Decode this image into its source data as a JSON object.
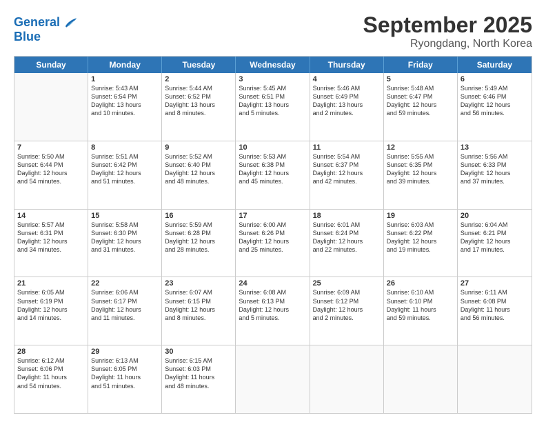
{
  "logo": {
    "line1": "General",
    "line2": "Blue"
  },
  "title": "September 2025",
  "subtitle": "Ryongdang, North Korea",
  "days": [
    "Sunday",
    "Monday",
    "Tuesday",
    "Wednesday",
    "Thursday",
    "Friday",
    "Saturday"
  ],
  "rows": [
    [
      {
        "day": "",
        "empty": true
      },
      {
        "day": "1",
        "l1": "Sunrise: 5:43 AM",
        "l2": "Sunset: 6:54 PM",
        "l3": "Daylight: 13 hours",
        "l4": "and 10 minutes."
      },
      {
        "day": "2",
        "l1": "Sunrise: 5:44 AM",
        "l2": "Sunset: 6:52 PM",
        "l3": "Daylight: 13 hours",
        "l4": "and 8 minutes."
      },
      {
        "day": "3",
        "l1": "Sunrise: 5:45 AM",
        "l2": "Sunset: 6:51 PM",
        "l3": "Daylight: 13 hours",
        "l4": "and 5 minutes."
      },
      {
        "day": "4",
        "l1": "Sunrise: 5:46 AM",
        "l2": "Sunset: 6:49 PM",
        "l3": "Daylight: 13 hours",
        "l4": "and 2 minutes."
      },
      {
        "day": "5",
        "l1": "Sunrise: 5:48 AM",
        "l2": "Sunset: 6:47 PM",
        "l3": "Daylight: 12 hours",
        "l4": "and 59 minutes."
      },
      {
        "day": "6",
        "l1": "Sunrise: 5:49 AM",
        "l2": "Sunset: 6:46 PM",
        "l3": "Daylight: 12 hours",
        "l4": "and 56 minutes."
      }
    ],
    [
      {
        "day": "7",
        "l1": "Sunrise: 5:50 AM",
        "l2": "Sunset: 6:44 PM",
        "l3": "Daylight: 12 hours",
        "l4": "and 54 minutes."
      },
      {
        "day": "8",
        "l1": "Sunrise: 5:51 AM",
        "l2": "Sunset: 6:42 PM",
        "l3": "Daylight: 12 hours",
        "l4": "and 51 minutes."
      },
      {
        "day": "9",
        "l1": "Sunrise: 5:52 AM",
        "l2": "Sunset: 6:40 PM",
        "l3": "Daylight: 12 hours",
        "l4": "and 48 minutes."
      },
      {
        "day": "10",
        "l1": "Sunrise: 5:53 AM",
        "l2": "Sunset: 6:38 PM",
        "l3": "Daylight: 12 hours",
        "l4": "and 45 minutes."
      },
      {
        "day": "11",
        "l1": "Sunrise: 5:54 AM",
        "l2": "Sunset: 6:37 PM",
        "l3": "Daylight: 12 hours",
        "l4": "and 42 minutes."
      },
      {
        "day": "12",
        "l1": "Sunrise: 5:55 AM",
        "l2": "Sunset: 6:35 PM",
        "l3": "Daylight: 12 hours",
        "l4": "and 39 minutes."
      },
      {
        "day": "13",
        "l1": "Sunrise: 5:56 AM",
        "l2": "Sunset: 6:33 PM",
        "l3": "Daylight: 12 hours",
        "l4": "and 37 minutes."
      }
    ],
    [
      {
        "day": "14",
        "l1": "Sunrise: 5:57 AM",
        "l2": "Sunset: 6:31 PM",
        "l3": "Daylight: 12 hours",
        "l4": "and 34 minutes."
      },
      {
        "day": "15",
        "l1": "Sunrise: 5:58 AM",
        "l2": "Sunset: 6:30 PM",
        "l3": "Daylight: 12 hours",
        "l4": "and 31 minutes."
      },
      {
        "day": "16",
        "l1": "Sunrise: 5:59 AM",
        "l2": "Sunset: 6:28 PM",
        "l3": "Daylight: 12 hours",
        "l4": "and 28 minutes."
      },
      {
        "day": "17",
        "l1": "Sunrise: 6:00 AM",
        "l2": "Sunset: 6:26 PM",
        "l3": "Daylight: 12 hours",
        "l4": "and 25 minutes."
      },
      {
        "day": "18",
        "l1": "Sunrise: 6:01 AM",
        "l2": "Sunset: 6:24 PM",
        "l3": "Daylight: 12 hours",
        "l4": "and 22 minutes."
      },
      {
        "day": "19",
        "l1": "Sunrise: 6:03 AM",
        "l2": "Sunset: 6:22 PM",
        "l3": "Daylight: 12 hours",
        "l4": "and 19 minutes."
      },
      {
        "day": "20",
        "l1": "Sunrise: 6:04 AM",
        "l2": "Sunset: 6:21 PM",
        "l3": "Daylight: 12 hours",
        "l4": "and 17 minutes."
      }
    ],
    [
      {
        "day": "21",
        "l1": "Sunrise: 6:05 AM",
        "l2": "Sunset: 6:19 PM",
        "l3": "Daylight: 12 hours",
        "l4": "and 14 minutes."
      },
      {
        "day": "22",
        "l1": "Sunrise: 6:06 AM",
        "l2": "Sunset: 6:17 PM",
        "l3": "Daylight: 12 hours",
        "l4": "and 11 minutes."
      },
      {
        "day": "23",
        "l1": "Sunrise: 6:07 AM",
        "l2": "Sunset: 6:15 PM",
        "l3": "Daylight: 12 hours",
        "l4": "and 8 minutes."
      },
      {
        "day": "24",
        "l1": "Sunrise: 6:08 AM",
        "l2": "Sunset: 6:13 PM",
        "l3": "Daylight: 12 hours",
        "l4": "and 5 minutes."
      },
      {
        "day": "25",
        "l1": "Sunrise: 6:09 AM",
        "l2": "Sunset: 6:12 PM",
        "l3": "Daylight: 12 hours",
        "l4": "and 2 minutes."
      },
      {
        "day": "26",
        "l1": "Sunrise: 6:10 AM",
        "l2": "Sunset: 6:10 PM",
        "l3": "Daylight: 11 hours",
        "l4": "and 59 minutes."
      },
      {
        "day": "27",
        "l1": "Sunrise: 6:11 AM",
        "l2": "Sunset: 6:08 PM",
        "l3": "Daylight: 11 hours",
        "l4": "and 56 minutes."
      }
    ],
    [
      {
        "day": "28",
        "l1": "Sunrise: 6:12 AM",
        "l2": "Sunset: 6:06 PM",
        "l3": "Daylight: 11 hours",
        "l4": "and 54 minutes."
      },
      {
        "day": "29",
        "l1": "Sunrise: 6:13 AM",
        "l2": "Sunset: 6:05 PM",
        "l3": "Daylight: 11 hours",
        "l4": "and 51 minutes."
      },
      {
        "day": "30",
        "l1": "Sunrise: 6:15 AM",
        "l2": "Sunset: 6:03 PM",
        "l3": "Daylight: 11 hours",
        "l4": "and 48 minutes."
      },
      {
        "day": "",
        "empty": true
      },
      {
        "day": "",
        "empty": true
      },
      {
        "day": "",
        "empty": true
      },
      {
        "day": "",
        "empty": true
      }
    ]
  ]
}
